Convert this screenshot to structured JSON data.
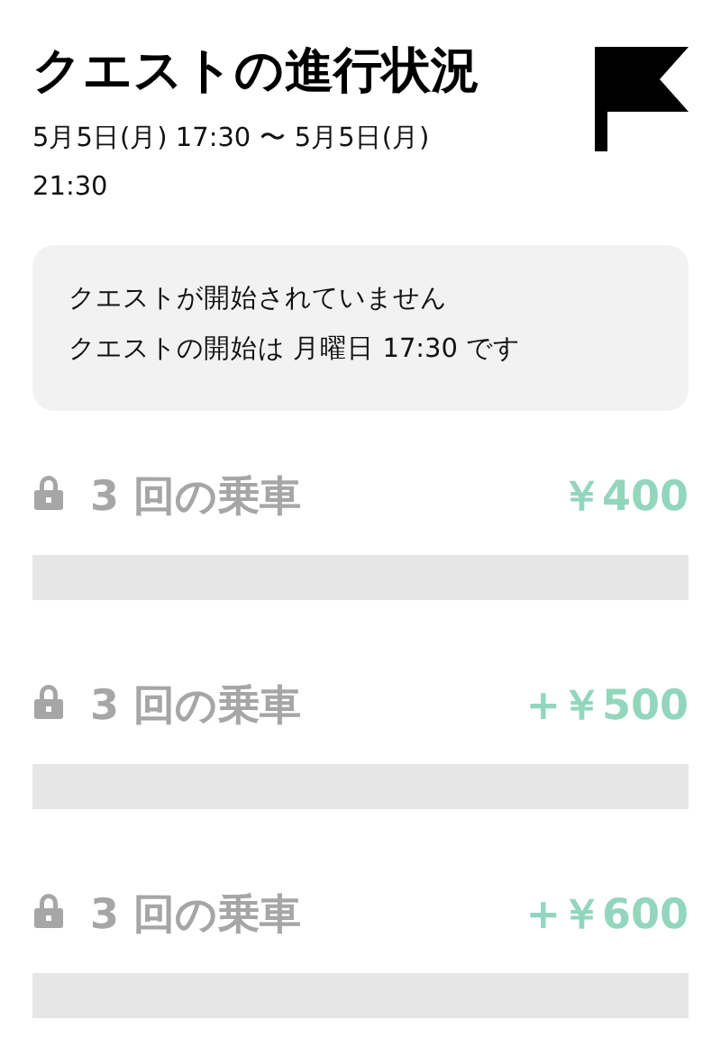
{
  "header": {
    "title": "クエストの進行状況",
    "date_range": "5月5日(月) 17:30 〜 5月5日(月) 21:30"
  },
  "notice": {
    "lines": [
      "クエストが開始されていません",
      "クエストの開始は 月曜日 17:30 です"
    ]
  },
  "quests": [
    {
      "label": "3 回の乗車",
      "reward": "￥400",
      "locked": true
    },
    {
      "label": "3 回の乗車",
      "reward": "+￥500",
      "locked": true
    },
    {
      "label": "3 回の乗車",
      "reward": "+￥600",
      "locked": true
    }
  ]
}
